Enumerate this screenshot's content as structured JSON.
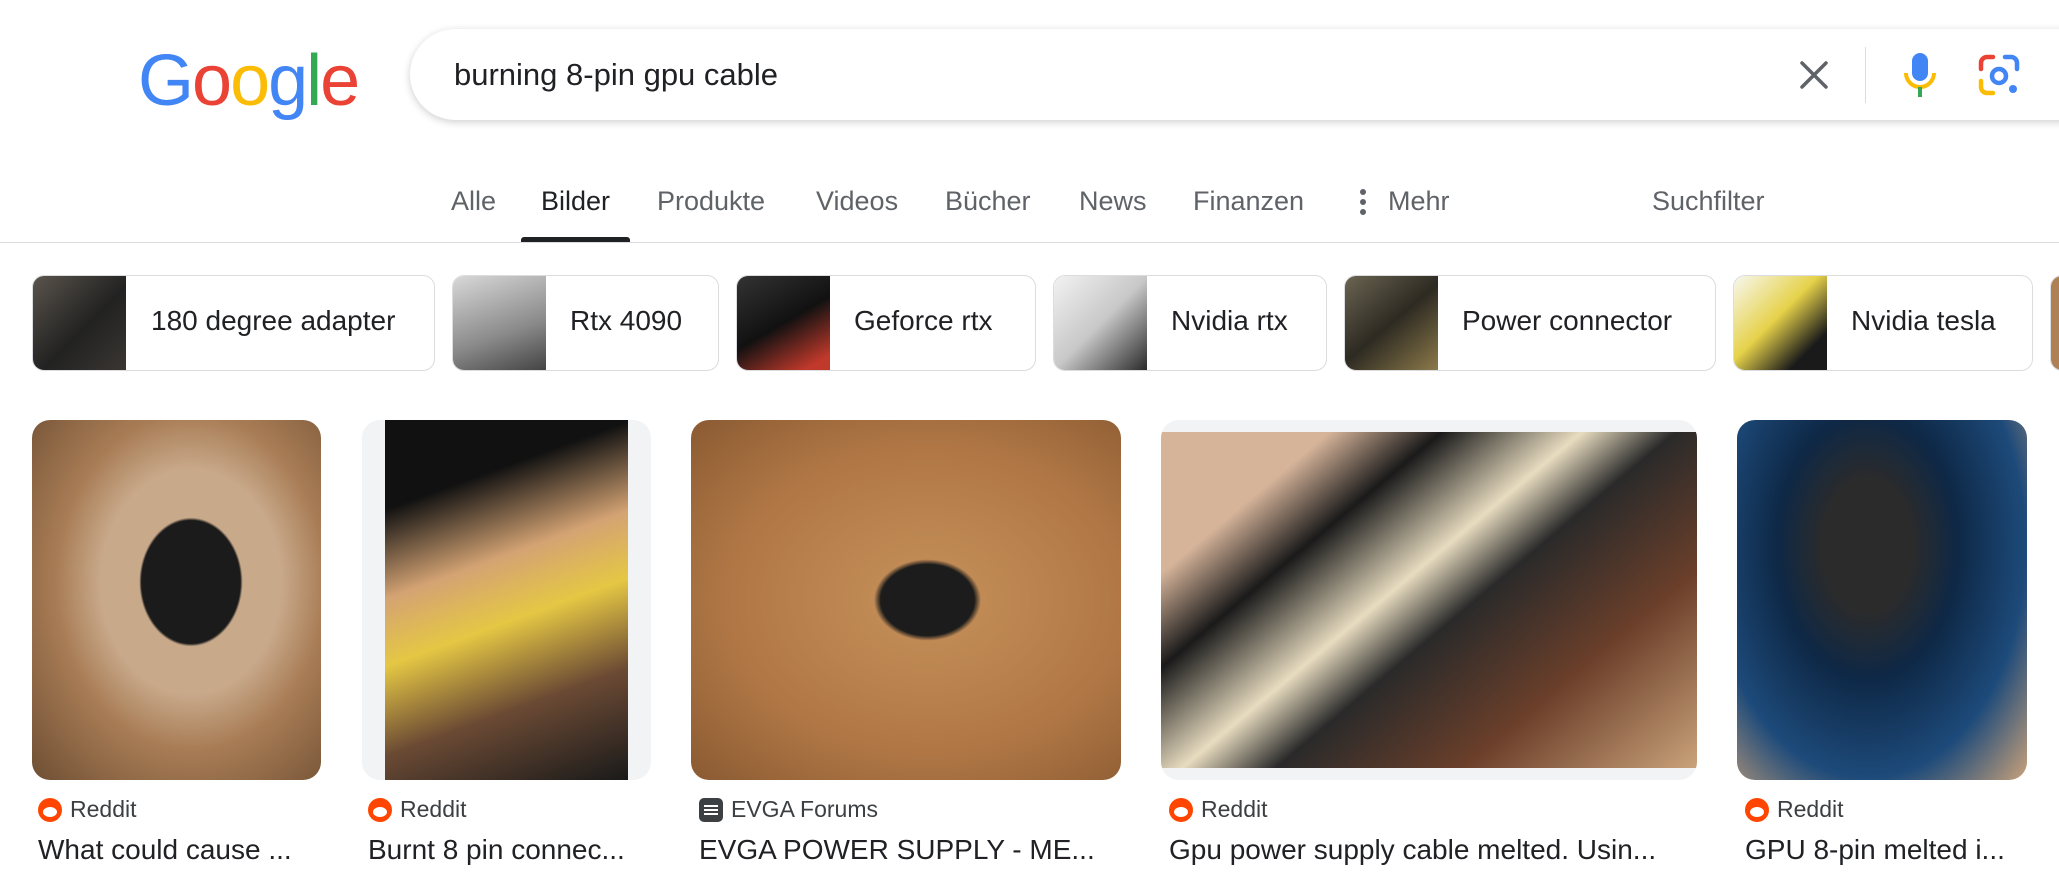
{
  "logo": {
    "letters": [
      "G",
      "o",
      "o",
      "g",
      "l",
      "e"
    ],
    "colors": [
      "#4285F4",
      "#EA4335",
      "#FBBC05",
      "#4285F4",
      "#34A853",
      "#EA4335"
    ]
  },
  "search": {
    "value": "burning 8-pin gpu cable",
    "placeholder": ""
  },
  "icons": {
    "clear": "close-icon",
    "mic": "microphone-icon",
    "lens": "google-lens-icon"
  },
  "tabs": [
    {
      "label": "Alle"
    },
    {
      "label": "Bilder",
      "active": true
    },
    {
      "label": "Produkte"
    },
    {
      "label": "Videos"
    },
    {
      "label": "Bücher"
    },
    {
      "label": "News"
    },
    {
      "label": "Finanzen"
    },
    {
      "label": "Mehr"
    }
  ],
  "tools": {
    "label": "Suchfilter"
  },
  "chips": [
    {
      "label": "180 degree adapter"
    },
    {
      "label": "Rtx 4090"
    },
    {
      "label": "Geforce rtx"
    },
    {
      "label": "Nvidia rtx"
    },
    {
      "label": "Power connector"
    },
    {
      "label": "Nvidia tesla"
    }
  ],
  "results": [
    {
      "source": "Reddit",
      "title": "What could cause ..."
    },
    {
      "source": "Reddit",
      "title": "Burnt 8 pin connec..."
    },
    {
      "source": "EVGA Forums",
      "title": "EVGA POWER SUPPLY - ME..."
    },
    {
      "source": "Reddit",
      "title": "Gpu power supply cable melted. Usin..."
    },
    {
      "source": "Reddit",
      "title": "GPU 8-pin melted i..."
    }
  ],
  "colors": {
    "reddit": "#FF4500",
    "text": "#202124",
    "muted": "#5f6368",
    "border": "#dadce0"
  }
}
